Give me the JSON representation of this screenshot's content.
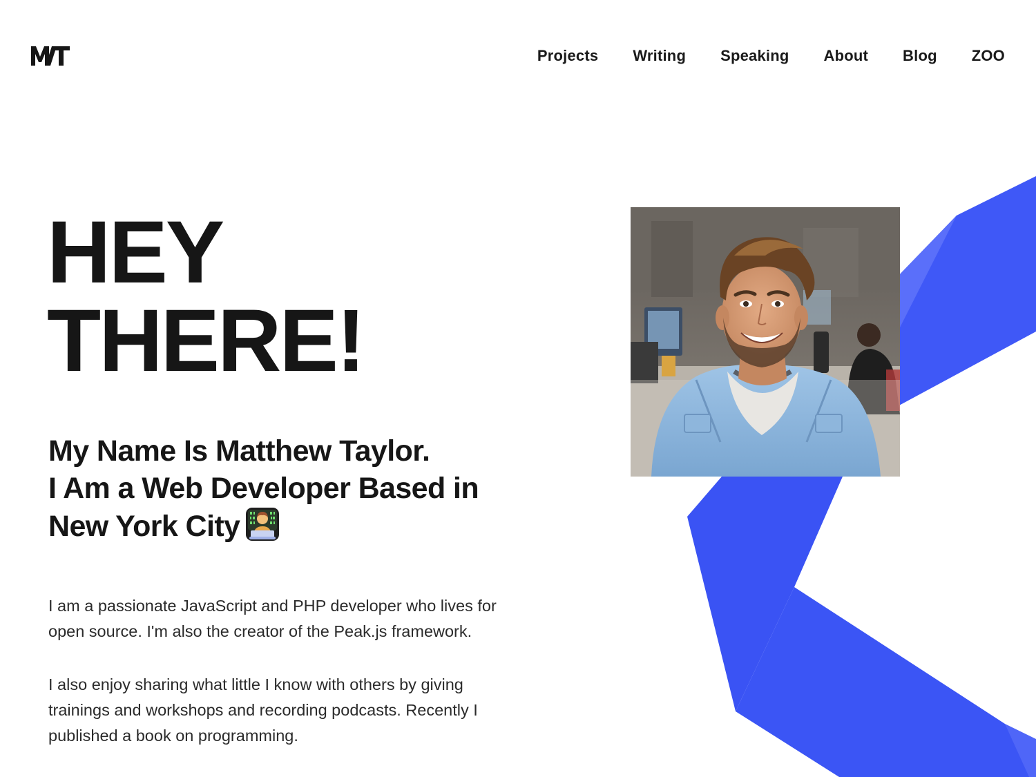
{
  "header": {
    "logo_text": "MT",
    "nav": [
      {
        "label": "Projects"
      },
      {
        "label": "Writing"
      },
      {
        "label": "Speaking"
      },
      {
        "label": "About"
      },
      {
        "label": "Blog"
      },
      {
        "label": "ZOO"
      }
    ]
  },
  "hero": {
    "title_line1": "HEY",
    "title_line2": "THERE!",
    "subtitle_line1": "My Name Is Matthew Taylor.",
    "subtitle_line2": "I Am a Web Developer Based in",
    "subtitle_line3": "New York City",
    "subtitle_icon": "technologist-emoji-icon"
  },
  "bio": {
    "paragraph1": "I am a passionate JavaScript and PHP developer who lives for open source. I'm also the creator of the Peak.js framework.",
    "paragraph2": "I also enjoy sharing what little I know with others by giving trainings and workshops and recording podcasts. Recently I published a book on programming."
  },
  "colors": {
    "accent": "#3d56f5",
    "text": "#161616"
  }
}
